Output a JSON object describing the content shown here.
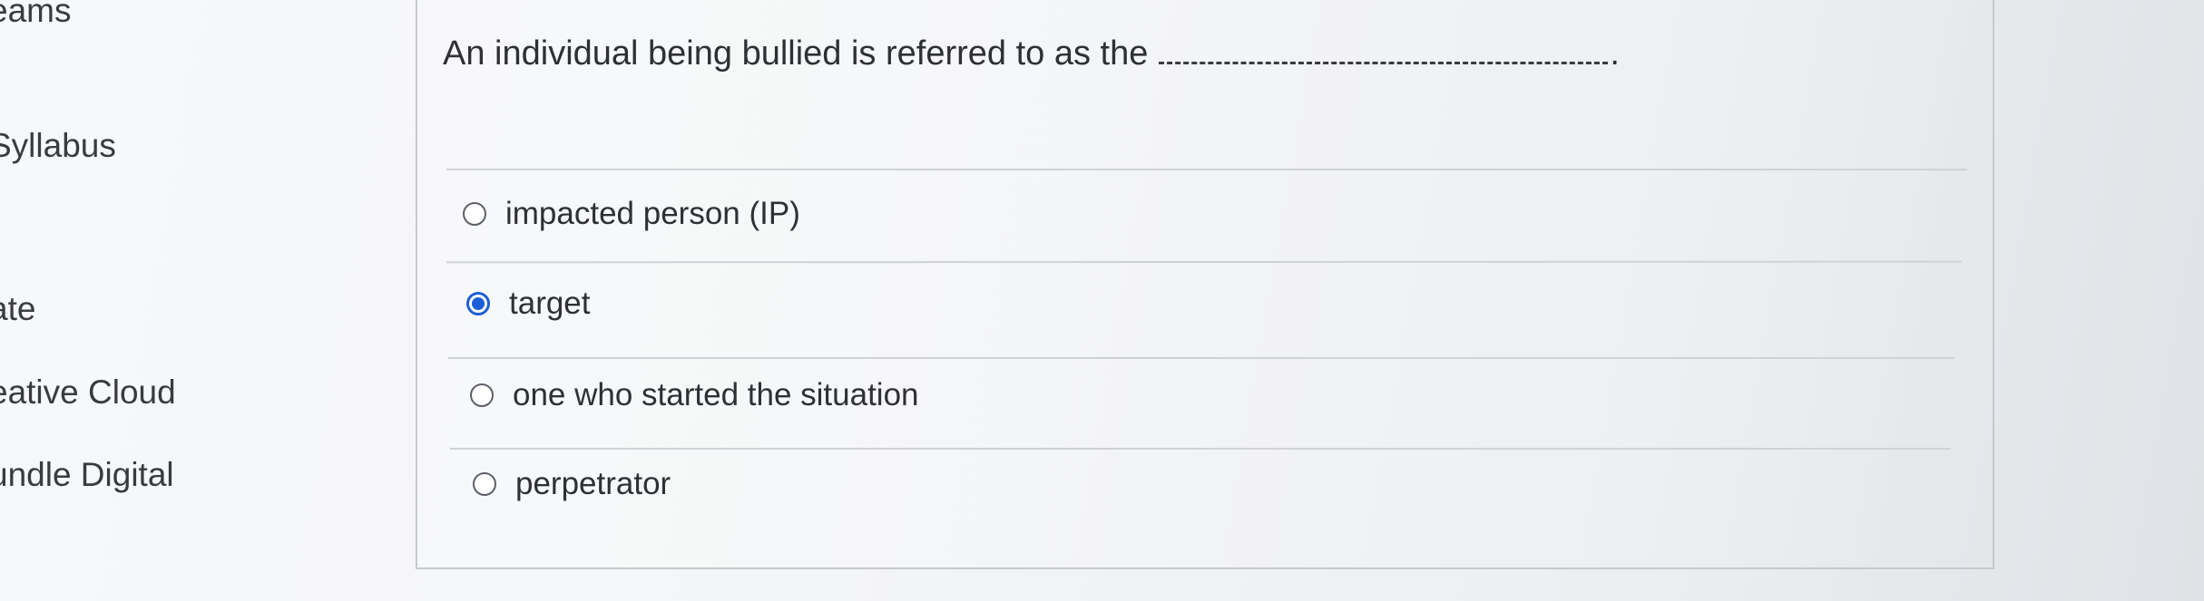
{
  "sidebar": {
    "items": [
      {
        "label": "eams"
      },
      {
        "label": "Syllabus"
      },
      {
        "label": "ate"
      },
      {
        "label": "eative Cloud"
      },
      {
        "label": "undle Digital"
      }
    ]
  },
  "question": {
    "text": "An individual being bullied is referred to as the",
    "blank_end": "."
  },
  "answers": [
    {
      "label": "impacted person (IP)",
      "selected": false
    },
    {
      "label": "target",
      "selected": true
    },
    {
      "label": "one who started the situation",
      "selected": false
    },
    {
      "label": "perpetrator",
      "selected": false
    }
  ],
  "colors": {
    "radio_selected": "#1b5fd6",
    "text": "#2f3033",
    "divider": "#cfd2d6"
  }
}
